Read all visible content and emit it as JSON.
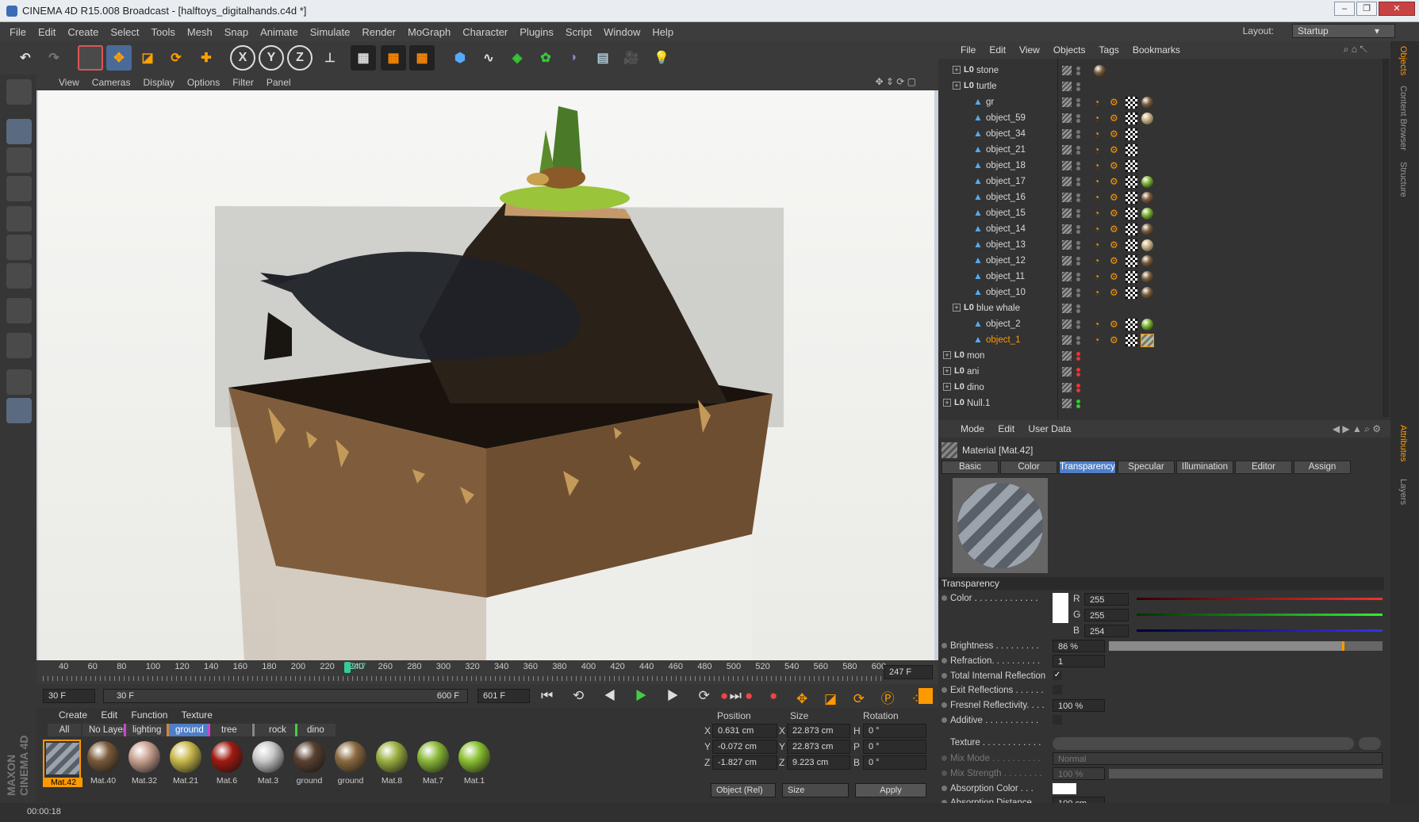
{
  "window": {
    "title": "CINEMA 4D R15.008 Broadcast - [halftoys_digitalhands.c4d *]",
    "controls": [
      "–",
      "❐",
      "✕"
    ]
  },
  "menubar": {
    "items": [
      "File",
      "Edit",
      "Create",
      "Select",
      "Tools",
      "Mesh",
      "Snap",
      "Animate",
      "Simulate",
      "Render",
      "MoGraph",
      "Character",
      "Plugins",
      "Script",
      "Window",
      "Help"
    ],
    "layout_label": "Layout:",
    "layout_value": "Startup"
  },
  "toolbar": {
    "axis_x": "X",
    "axis_y": "Y",
    "axis_z": "Z"
  },
  "viewport": {
    "menu": [
      "View",
      "Cameras",
      "Display",
      "Options",
      "Filter",
      "Panel"
    ]
  },
  "timeline": {
    "ticks": [
      "40",
      "60",
      "80",
      "100",
      "120",
      "140",
      "160",
      "180",
      "200",
      "220",
      "240",
      "260",
      "280",
      "300",
      "320",
      "340",
      "360",
      "380",
      "400",
      "420",
      "440",
      "460",
      "480",
      "500",
      "520",
      "540",
      "560",
      "580",
      "600"
    ],
    "current_marker": "247",
    "current_frame": "247 F",
    "start_frame": "30 F",
    "range_start": "30 F",
    "range_end": "600 F",
    "end_frame": "601 F"
  },
  "materials": {
    "menu": [
      "Create",
      "Edit",
      "Function",
      "Texture"
    ],
    "layer_tabs": [
      "All",
      "No Layer",
      "lighting",
      "ground",
      "tree",
      "rock",
      "dino"
    ],
    "active_layer": "ground",
    "items": [
      {
        "name": "Mat.42",
        "color": "#8a8f96"
      },
      {
        "name": "Mat.40",
        "color": "#7a5a3a"
      },
      {
        "name": "Mat.32",
        "color": "#c9a090"
      },
      {
        "name": "Mat.21",
        "color": "#c8b84a"
      },
      {
        "name": "Mat.6",
        "color": "#a01a10"
      },
      {
        "name": "Mat.3",
        "color": "#c8c8c8"
      },
      {
        "name": "ground",
        "color": "#5a4030"
      },
      {
        "name": "ground",
        "color": "#8a6a40"
      },
      {
        "name": "Mat.8",
        "color": "#9ab040"
      },
      {
        "name": "Mat.7",
        "color": "#8ab838"
      },
      {
        "name": "Mat.1",
        "color": "#8ac030"
      }
    ]
  },
  "coords": {
    "headers": [
      "Position",
      "Size",
      "Rotation"
    ],
    "rows": [
      {
        "axis": "X",
        "pos": "0.631 cm",
        "saxis": "X",
        "size": "22.873 cm",
        "raxis": "H",
        "rot": "0 °"
      },
      {
        "axis": "Y",
        "pos": "-0.072 cm",
        "saxis": "Y",
        "size": "22.873 cm",
        "raxis": "P",
        "rot": "0 °"
      },
      {
        "axis": "Z",
        "pos": "-1.827 cm",
        "saxis": "Z",
        "size": "9.223 cm",
        "raxis": "B",
        "rot": "0 °"
      }
    ],
    "mode": "Object (Rel)",
    "size_mode": "Size",
    "apply": "Apply"
  },
  "objects": {
    "menu": [
      "File",
      "Edit",
      "View",
      "Objects",
      "Tags",
      "Bookmarks"
    ],
    "rows": [
      {
        "name": "stone",
        "type": "null",
        "expand": true,
        "indent": 1,
        "tags": [
          "ball-brown"
        ]
      },
      {
        "name": "turtle",
        "type": "null",
        "expand": true,
        "indent": 1,
        "tags": []
      },
      {
        "name": "gr",
        "type": "poly",
        "indent": 2,
        "tags": [
          "phong",
          "uvw",
          "checker",
          "ball-brown"
        ]
      },
      {
        "name": "object_59",
        "type": "poly",
        "indent": 2,
        "tags": [
          "phong",
          "uvw",
          "checker",
          "ball-tan"
        ]
      },
      {
        "name": "object_34",
        "type": "poly",
        "indent": 2,
        "tags": [
          "phong",
          "uvw",
          "checker"
        ]
      },
      {
        "name": "object_21",
        "type": "poly",
        "indent": 2,
        "tags": [
          "phong",
          "uvw",
          "checker"
        ]
      },
      {
        "name": "object_18",
        "type": "poly",
        "indent": 2,
        "tags": [
          "phong",
          "uvw",
          "checker"
        ]
      },
      {
        "name": "object_17",
        "type": "poly",
        "indent": 2,
        "tags": [
          "phong",
          "uvw",
          "checker",
          "ball-green"
        ]
      },
      {
        "name": "object_16",
        "type": "poly",
        "indent": 2,
        "tags": [
          "phong",
          "uvw",
          "checker",
          "ball-brown"
        ]
      },
      {
        "name": "object_15",
        "type": "poly",
        "indent": 2,
        "tags": [
          "phong",
          "uvw",
          "checker",
          "ball-green"
        ]
      },
      {
        "name": "object_14",
        "type": "poly",
        "indent": 2,
        "tags": [
          "phong",
          "uvw",
          "checker",
          "ball-brown"
        ]
      },
      {
        "name": "object_13",
        "type": "poly",
        "indent": 2,
        "tags": [
          "phong",
          "uvw",
          "checker",
          "ball-tan"
        ]
      },
      {
        "name": "object_12",
        "type": "poly",
        "indent": 2,
        "tags": [
          "phong",
          "uvw",
          "checker",
          "ball-brown"
        ]
      },
      {
        "name": "object_11",
        "type": "poly",
        "indent": 2,
        "tags": [
          "phong",
          "uvw",
          "checker",
          "ball-brown"
        ]
      },
      {
        "name": "object_10",
        "type": "poly",
        "indent": 2,
        "tags": [
          "phong",
          "uvw",
          "checker",
          "ball-brown"
        ]
      },
      {
        "name": "blue whale",
        "type": "null",
        "expand": true,
        "indent": 1,
        "tags": []
      },
      {
        "name": "object_2",
        "type": "poly",
        "indent": 2,
        "tags": [
          "phong",
          "uvw",
          "checker",
          "ball-green"
        ]
      },
      {
        "name": "object_1",
        "type": "poly",
        "indent": 2,
        "selected": true,
        "tags": [
          "phong",
          "uvw",
          "checker",
          "stripe"
        ]
      },
      {
        "name": "mon",
        "type": "null",
        "expand": true,
        "indent": 0,
        "tags": [],
        "dot": "red"
      },
      {
        "name": "ani",
        "type": "null",
        "expand": true,
        "indent": 0,
        "tags": [],
        "dot": "red"
      },
      {
        "name": "dino",
        "type": "null",
        "expand": true,
        "indent": 0,
        "tags": [],
        "dot": "red"
      },
      {
        "name": "Null.1",
        "type": "null",
        "expand": true,
        "indent": 0,
        "tags": [],
        "dot": "green"
      }
    ],
    "side_tabs": [
      "Objects",
      "Content Browser",
      "Structure"
    ]
  },
  "attributes": {
    "menu": [
      "Mode",
      "Edit",
      "User Data"
    ],
    "title": "Material [Mat.42]",
    "tabs": [
      "Basic",
      "Color",
      "Transparency",
      "Specular",
      "Illumination",
      "Editor",
      "Assign"
    ],
    "active_tab": "Transparency",
    "section": "Transparency",
    "color_label": "Color . . . . . . . . . . . . .",
    "r_label": "R",
    "r_value": "255",
    "g_label": "G",
    "g_value": "255",
    "b_label": "B",
    "b_value": "254",
    "brightness_label": "Brightness . . . . . . . . .",
    "brightness_value": "86 %",
    "brightness": 0.86,
    "refraction_label": "Refraction. . . . . . . . . .",
    "refraction_value": "1",
    "tir_label": "Total Internal Reflection",
    "tir_checked": "✓",
    "exit_label": "Exit Reflections . . . . . .",
    "fresnel_label": "Fresnel Reflectivity. . . .",
    "fresnel_value": "100 %",
    "additive_label": "Additive . . . . . . . . . . .",
    "texture_label": "Texture . . . . . . . . . . . .",
    "mixmode_label": "Mix Mode . . . . . . . . . .",
    "mixmode_value": "Normal",
    "mixstrength_label": "Mix Strength . . . . . . . .",
    "mixstrength_value": "100 %",
    "absorption_color_label": "Absorption Color . . .",
    "absorption_distance_label": "Absorption Distance . .",
    "absorption_distance_value": "100 cm",
    "side_tabs": [
      "Attributes",
      "Layers"
    ]
  },
  "status": {
    "time": "00:00:18"
  },
  "branding": "MAXON CINEMA 4D"
}
